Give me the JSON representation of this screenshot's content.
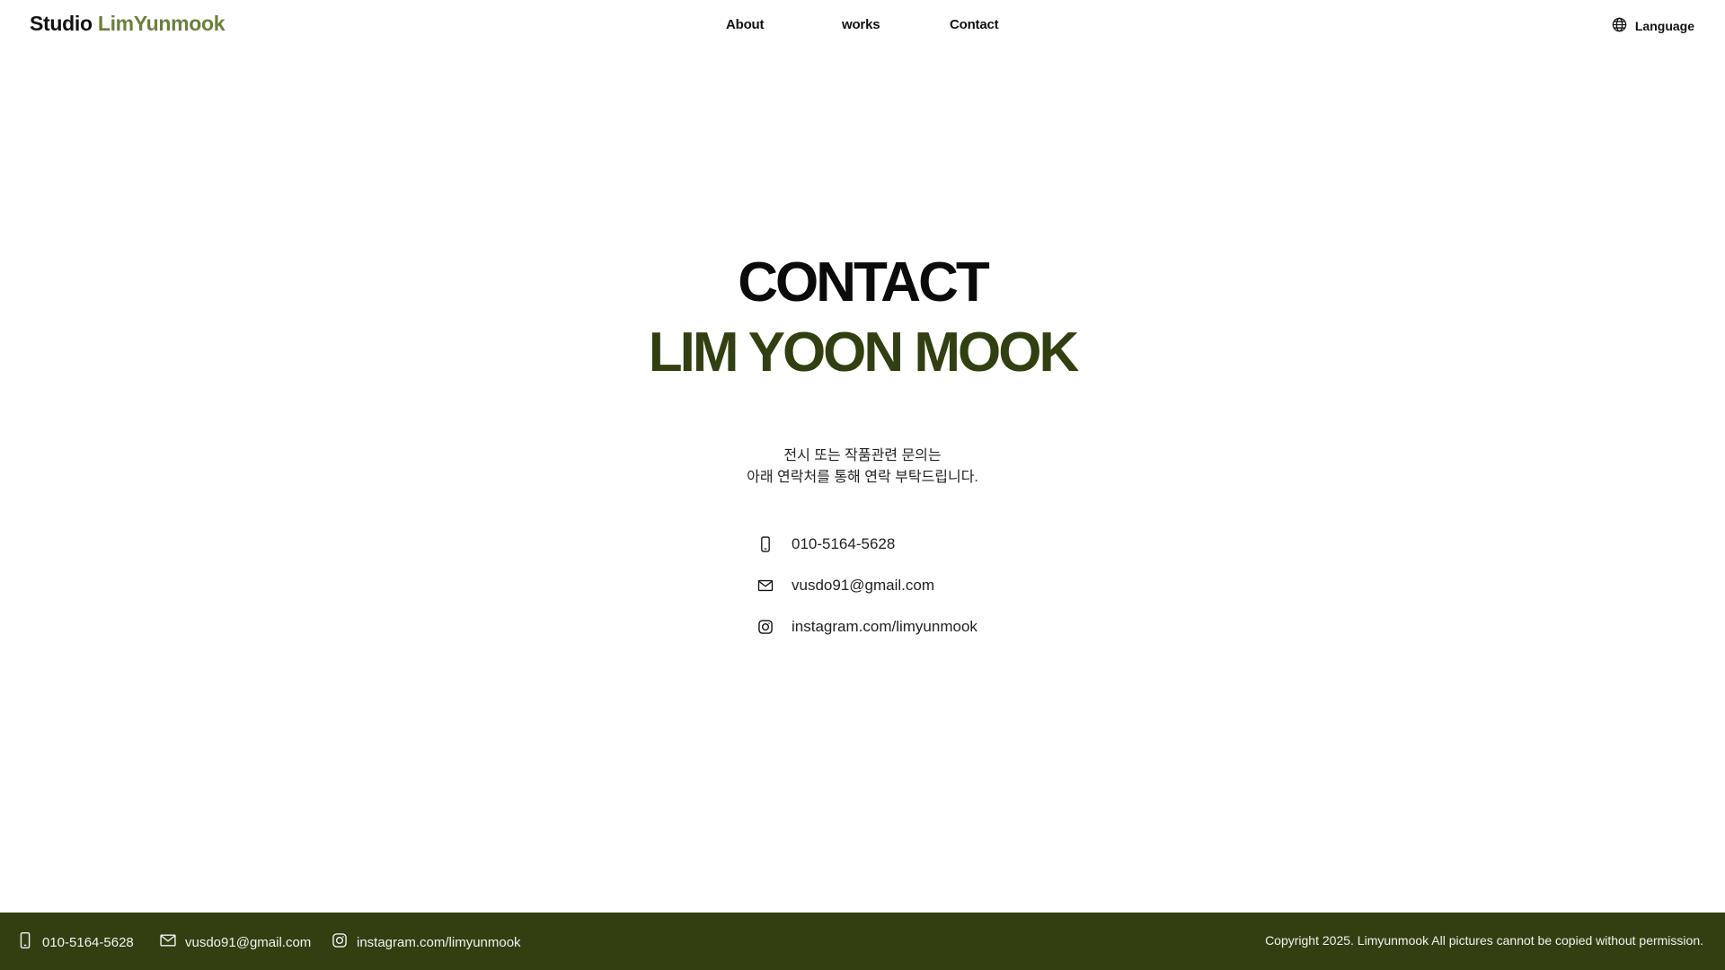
{
  "header": {
    "logo_part1": "Studio",
    "logo_part2": "LimYunmook",
    "nav": {
      "about": "About",
      "works": "works",
      "contact": "Contact"
    },
    "language_label": "Language",
    "language_icon": "globe-icon"
  },
  "main": {
    "title": "CONTACT",
    "name": "LIM YOON MOOK",
    "intro_line1": "전시 또는 작품관련 문의는",
    "intro_line2": "아래 연락처를 통해 연락 부탁드립니다.",
    "contacts": [
      {
        "icon": "phone-icon",
        "value": "010-5164-5628"
      },
      {
        "icon": "mail-icon",
        "value": "vusdo91@gmail.com"
      },
      {
        "icon": "instagram-icon",
        "value": "instagram.com/limyunmook"
      }
    ]
  },
  "footer": {
    "phone": "010-5164-5628",
    "email": "vusdo91@gmail.com",
    "instagram": "instagram.com/limyunmook",
    "copyright": "Copyright 2025. Limyunmook All pictures cannot be copied without permission."
  },
  "colors": {
    "accent_light": "#6b7f3c",
    "accent_dark": "#323f10",
    "footer_bg": "#323f10"
  }
}
